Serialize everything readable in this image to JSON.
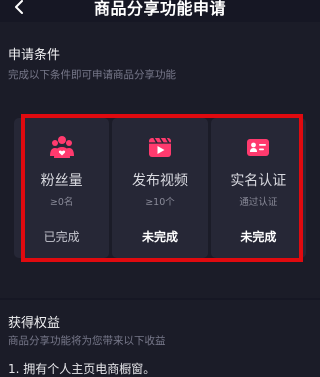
{
  "header": {
    "title": "商品分享功能申请"
  },
  "conditions": {
    "title": "申请条件",
    "subtitle": "完成以下条件即可申请商品分享功能",
    "cards": [
      {
        "icon": "fans-icon",
        "title": "粉丝量",
        "requirement": "≥0名",
        "status": "已完成"
      },
      {
        "icon": "video-publish-icon",
        "title": "发布视频",
        "requirement": "≥10个",
        "status": "未完成"
      },
      {
        "icon": "id-card-icon",
        "title": "实名认证",
        "requirement": "通过认证",
        "status": "未完成"
      }
    ]
  },
  "rights": {
    "title": "获得权益",
    "subtitle": "商品分享功能将为您带来以下收益",
    "items": [
      "1. 拥有个人主页电商橱窗。"
    ]
  },
  "colors": {
    "background": "#161724",
    "card": "#262736",
    "accent": "#ff3a6e",
    "highlight": "#e00a0f"
  }
}
